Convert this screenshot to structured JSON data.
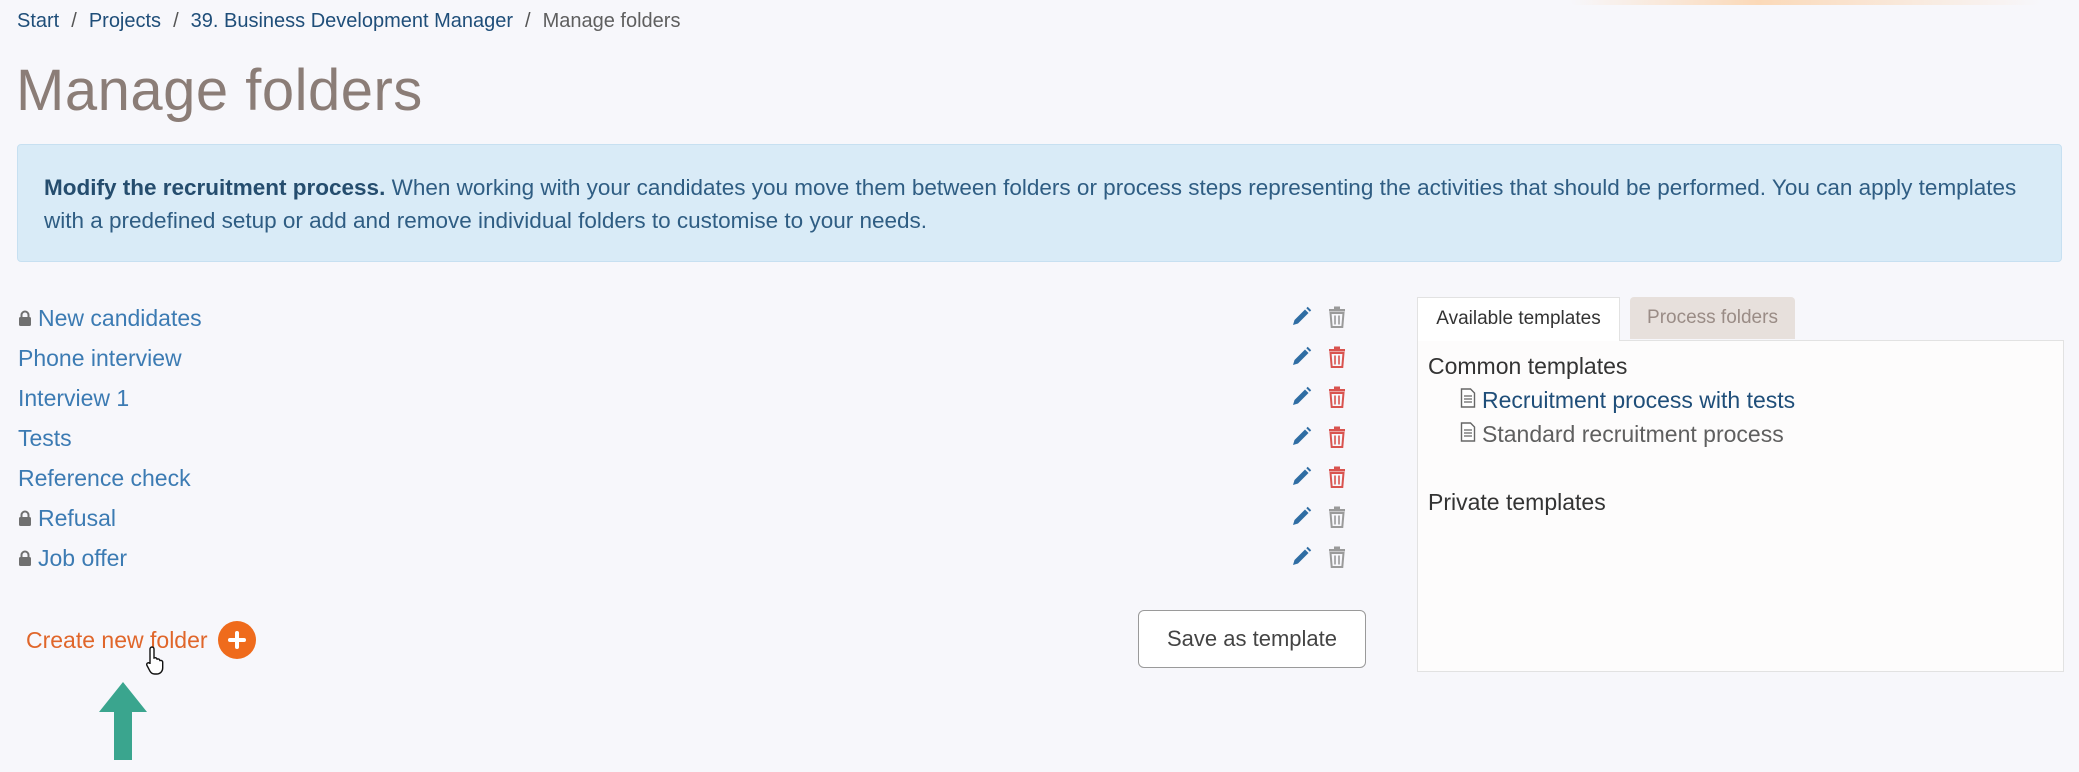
{
  "breadcrumb": {
    "items": [
      "Start",
      "Projects",
      "39. Business Development Manager"
    ],
    "current": "Manage folders",
    "separator": "/"
  },
  "page": {
    "title": "Manage folders"
  },
  "info": {
    "bold": "Modify the recruitment process.",
    "text": " When working with your candidates you move them between folders or process steps representing the activities that should be performed. You can apply templates with a predefined setup or add and remove individual folders to customise to your needs."
  },
  "folders": [
    {
      "label": "New candidates",
      "locked": true
    },
    {
      "label": "Phone interview",
      "locked": false
    },
    {
      "label": "Interview 1",
      "locked": false
    },
    {
      "label": "Tests",
      "locked": false
    },
    {
      "label": "Reference check",
      "locked": false
    },
    {
      "label": "Refusal",
      "locked": true
    },
    {
      "label": "Job offer",
      "locked": true
    }
  ],
  "actions": {
    "create_folder": "Create new folder",
    "save_template": "Save as template"
  },
  "tabs": {
    "available": "Available templates",
    "process": "Process folders"
  },
  "templates": {
    "common_heading": "Common templates",
    "common": [
      "Recruitment process with tests",
      "Standard recruitment process"
    ],
    "private_heading": "Private templates"
  },
  "colors": {
    "link": "#3c7bb3",
    "accent_orange": "#ef6b1c",
    "delete_red": "#d9534f",
    "delete_gray": "#9a9a9a",
    "arrow_teal": "#3aa58e"
  },
  "icons": {
    "lock": "lock-icon",
    "edit": "pencil-icon",
    "delete": "trash-icon",
    "add": "plus-circle-icon",
    "document": "document-icon"
  }
}
